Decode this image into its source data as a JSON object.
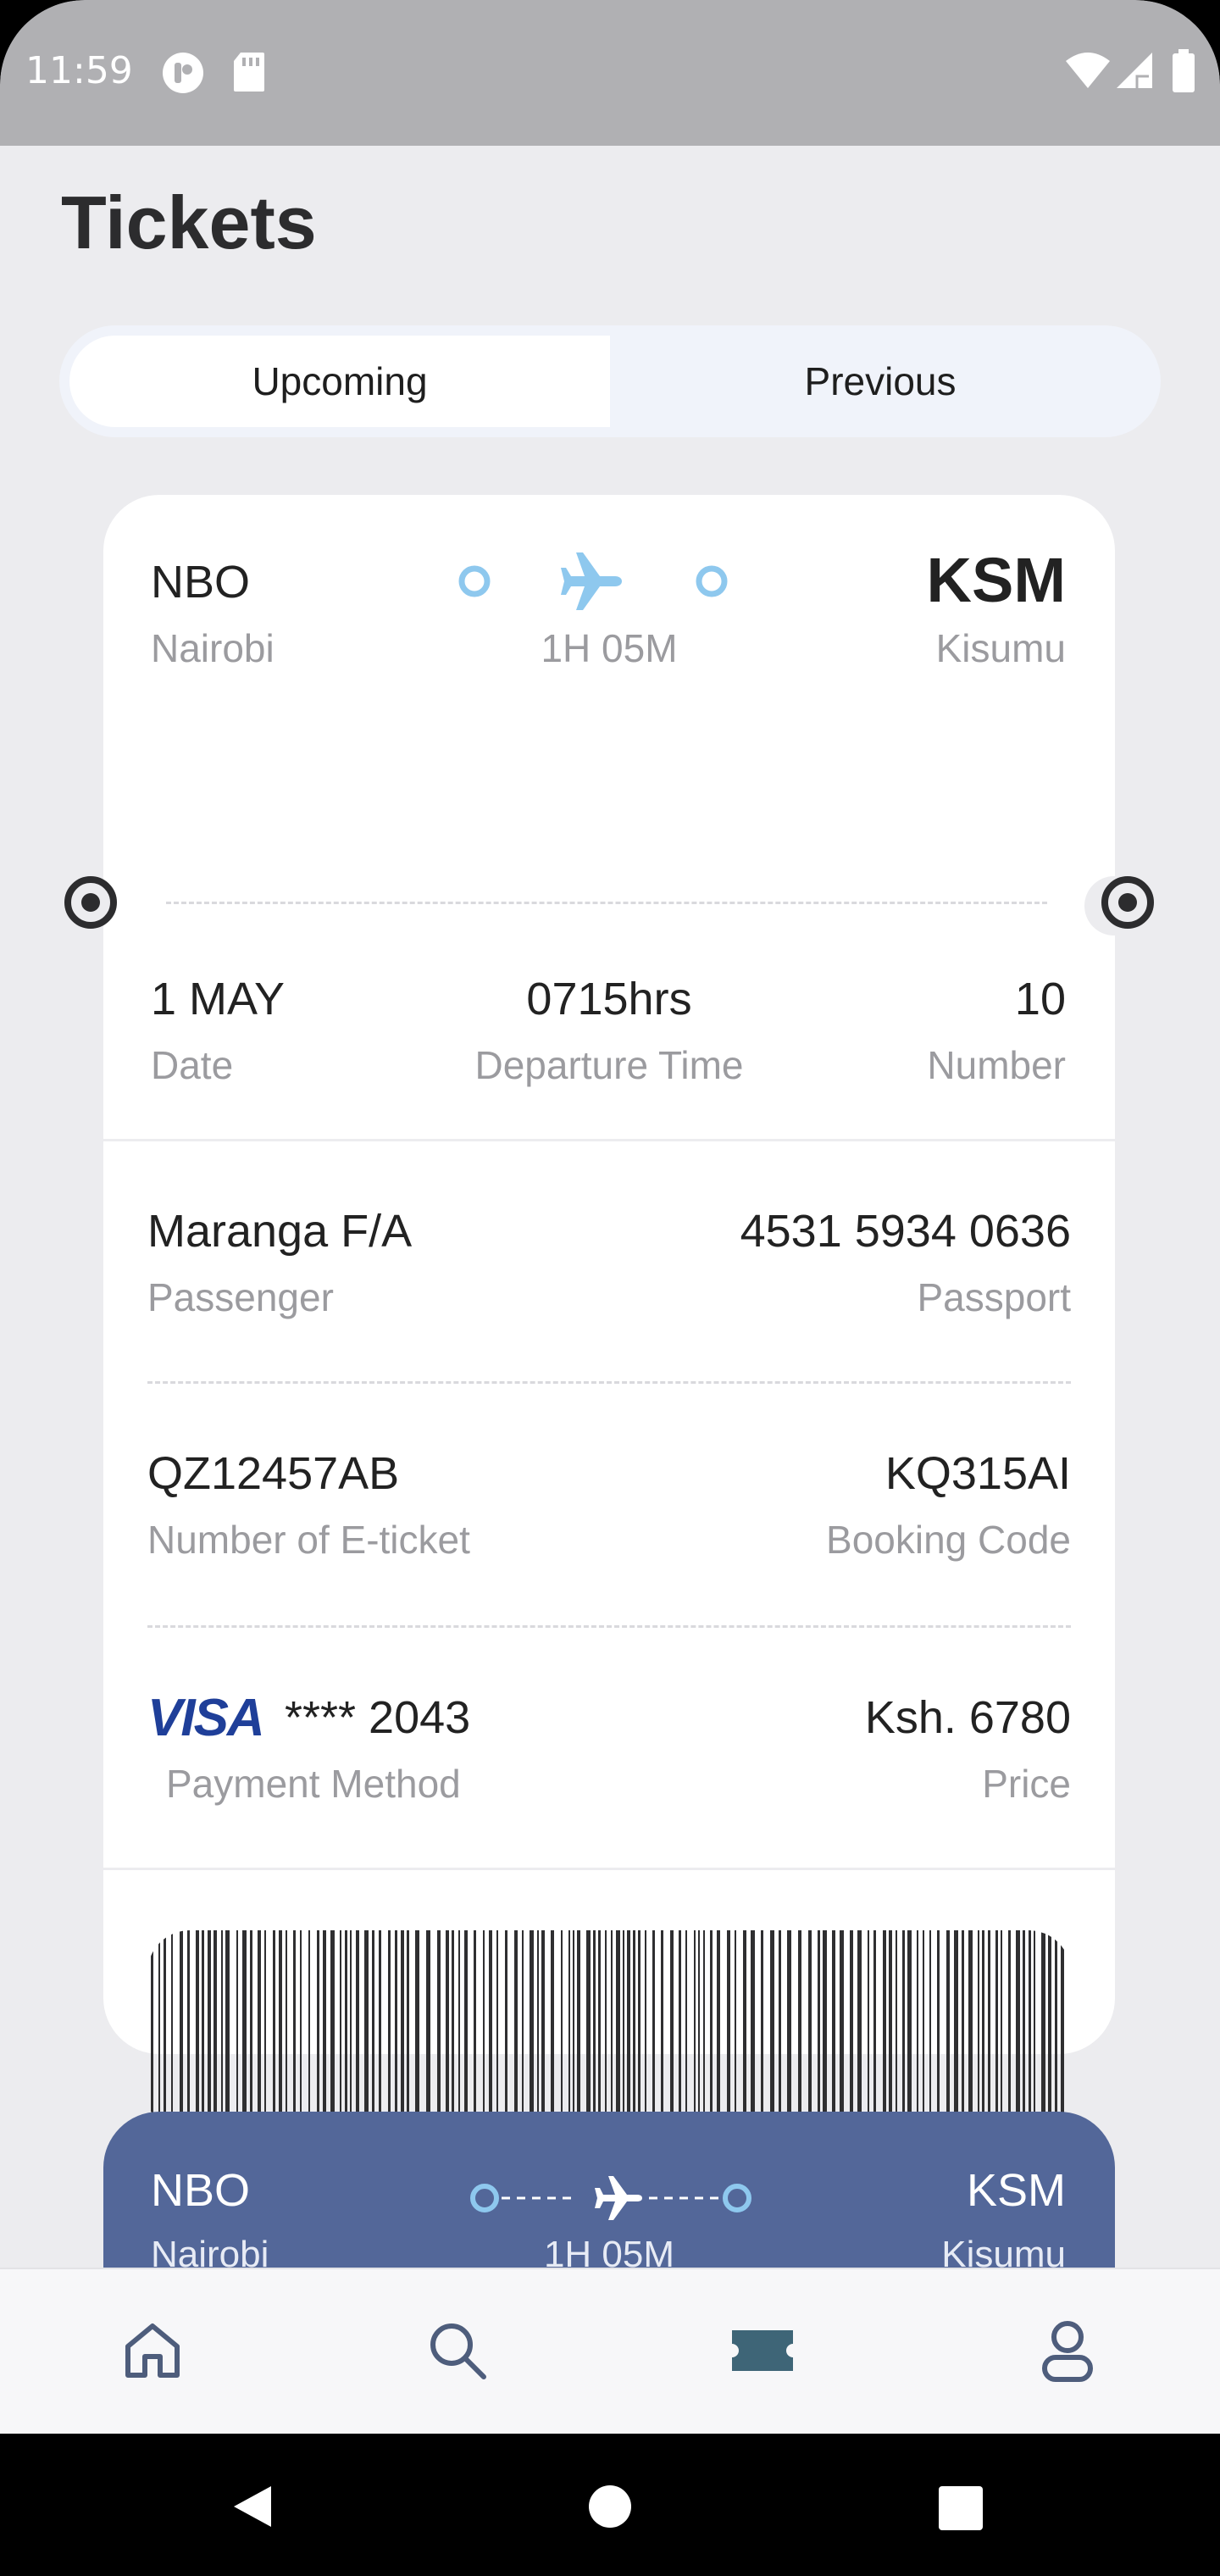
{
  "status_bar": {
    "time": "11:59",
    "icons": [
      "app-notification-icon",
      "sd-card-icon",
      "wifi-icon",
      "cellular-signal-icon",
      "battery-icon"
    ]
  },
  "page": {
    "title": "Tickets"
  },
  "tabs": [
    {
      "label": "Upcoming",
      "active": true
    },
    {
      "label": "Previous",
      "active": false
    }
  ],
  "ticket": {
    "origin_code": "NBO",
    "origin_city": "Nairobi",
    "destination_code": "KSM",
    "destination_city": "Kisumu",
    "duration": "1H 05M",
    "date_value": "1 MAY",
    "date_label": "Date",
    "departure_value": "0715hrs",
    "departure_label": "Departure Time",
    "number_value": "10",
    "number_label": "Number",
    "passenger_value": "Maranga F/A",
    "passenger_label": "Passenger",
    "passport_value": "4531 5934 0636",
    "passport_label": "Passport",
    "eticket_value": "QZ12457AB",
    "eticket_label": "Number of E-ticket",
    "booking_value": "KQ315AI",
    "booking_label": "Booking Code",
    "payment_brand": "VISA",
    "payment_value": "**** 2043",
    "payment_label": "Payment Method",
    "price_value": "Ksh. 6780",
    "price_label": "Price",
    "accent_color": "#8ec8ee"
  },
  "ticket2": {
    "origin_code": "NBO",
    "origin_city": "Nairobi",
    "destination_code": "KSM",
    "destination_city": "Kisumu",
    "duration": "1H 05M",
    "background_color": "#536799"
  },
  "bottom_nav": [
    {
      "name": "home",
      "icon": "home-icon"
    },
    {
      "name": "search",
      "icon": "search-icon"
    },
    {
      "name": "tickets",
      "icon": "ticket-icon",
      "active": true
    },
    {
      "name": "profile",
      "icon": "user-icon"
    }
  ],
  "system_nav": [
    "back-icon",
    "home-circle-icon",
    "recents-icon"
  ]
}
